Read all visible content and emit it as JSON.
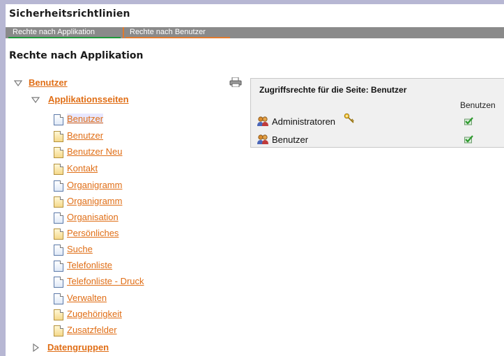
{
  "app": {
    "title": "Sicherheitsrichtlinien"
  },
  "tabs": [
    {
      "label": "Rechte nach Applikation",
      "active": true
    },
    {
      "label": "Rechte nach Benutzer",
      "active": false
    }
  ],
  "page": {
    "title": "Rechte nach Applikation"
  },
  "tree": {
    "root": {
      "label": "Benutzer",
      "expanded": true
    },
    "section": {
      "label": "Applikationsseiten",
      "expanded": true
    },
    "pages": [
      {
        "label": "Benutzer",
        "icon": "blue-page-icon",
        "selected": true
      },
      {
        "label": "Benutzer",
        "icon": "yellow-page-icon",
        "selected": false
      },
      {
        "label": "Benutzer Neu",
        "icon": "yellow-page-icon",
        "selected": false
      },
      {
        "label": "Kontakt",
        "icon": "yellow-page-icon",
        "selected": false
      },
      {
        "label": "Organigramm",
        "icon": "blue-page-icon",
        "selected": false
      },
      {
        "label": "Organigramm",
        "icon": "yellow-page-icon",
        "selected": false
      },
      {
        "label": "Organisation",
        "icon": "blue-page-icon",
        "selected": false
      },
      {
        "label": "Persönliches",
        "icon": "yellow-page-icon",
        "selected": false
      },
      {
        "label": "Suche",
        "icon": "blue-page-icon",
        "selected": false
      },
      {
        "label": "Telefonliste",
        "icon": "blue-page-icon",
        "selected": false
      },
      {
        "label": "Telefonliste - Druck",
        "icon": "blue-page-icon",
        "selected": false
      },
      {
        "label": "Verwalten",
        "icon": "blue-page-icon",
        "selected": false
      },
      {
        "label": "Zugehörigkeit",
        "icon": "yellow-page-icon",
        "selected": false
      },
      {
        "label": "Zusatzfelder",
        "icon": "yellow-page-icon",
        "selected": false
      }
    ],
    "collapsed_section": {
      "label": "Datengruppen",
      "expanded": false
    }
  },
  "permissions": {
    "title": "Zugriffsrechte für die Seite: Benutzer",
    "column": "Benutzen",
    "rows": [
      {
        "group": "Administratoren",
        "has_key": true,
        "allowed": true
      },
      {
        "group": "Benutzer",
        "has_key": false,
        "allowed": true
      }
    ]
  },
  "colors": {
    "link": "#e06e16",
    "tabbar": "#8a8a8a",
    "frame": "#b7b7d3",
    "active_tab": "#1e9a3a",
    "check": "#2e9a2e"
  }
}
